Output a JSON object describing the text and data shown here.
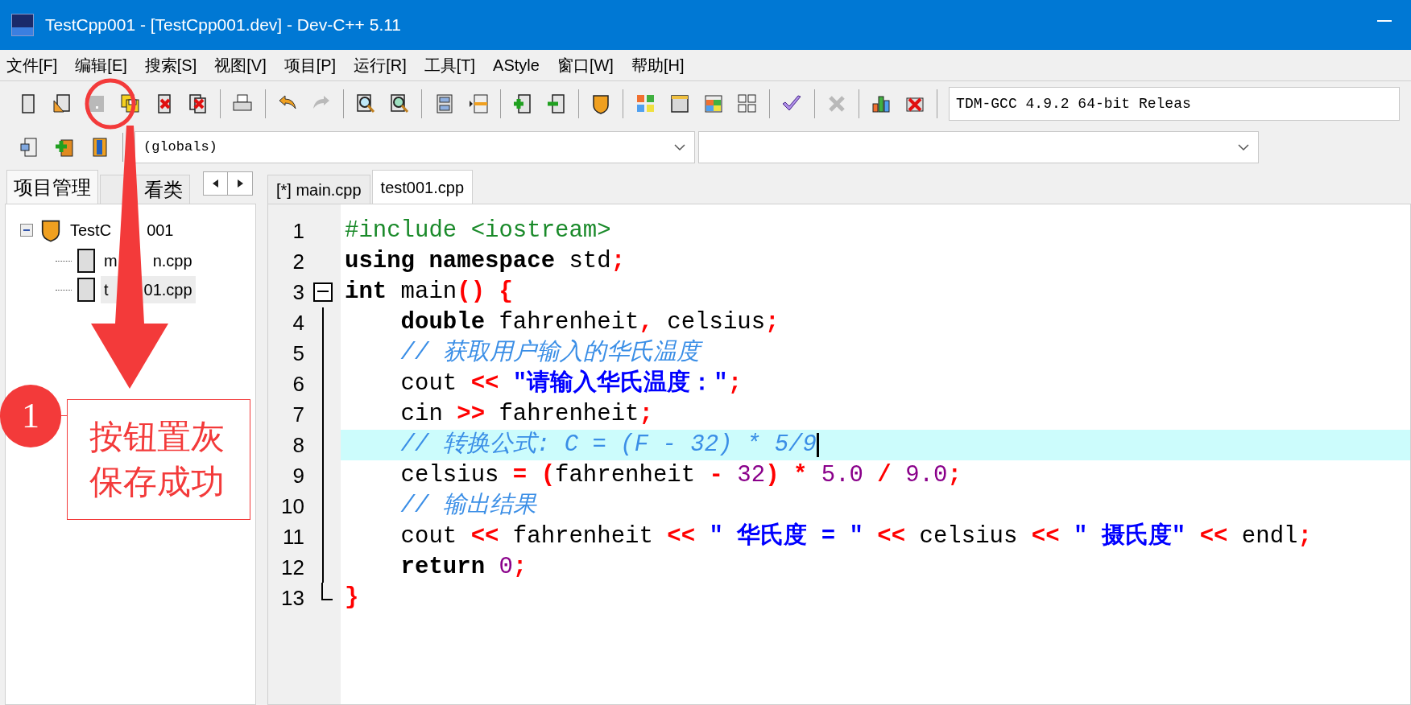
{
  "window": {
    "title": "TestCpp001 - [TestCpp001.dev] - Dev-C++ 5.11"
  },
  "menu": [
    "文件[F]",
    "编辑[E]",
    "搜索[S]",
    "视图[V]",
    "项目[P]",
    "运行[R]",
    "工具[T]",
    "AStyle",
    "窗口[W]",
    "帮助[H]"
  ],
  "toolbar": {
    "groups": [
      [
        {
          "kind": "page",
          "disabled": false
        },
        {
          "kind": "page-pencil",
          "disabled": false
        },
        {
          "kind": "save",
          "disabled": true
        },
        {
          "kind": "floppy-stack",
          "disabled": false
        },
        {
          "kind": "page-x",
          "disabled": false
        },
        {
          "kind": "pages-x",
          "disabled": false
        }
      ],
      [
        {
          "kind": "printer",
          "disabled": false
        }
      ],
      [
        {
          "kind": "undo-arrow",
          "disabled": false
        },
        {
          "kind": "redo-arrow",
          "disabled": true
        }
      ],
      [
        {
          "kind": "magnifier",
          "disabled": false
        },
        {
          "kind": "magnifier-page",
          "disabled": false
        }
      ],
      [
        {
          "kind": "panels",
          "disabled": false
        },
        {
          "kind": "split-bar",
          "disabled": false
        }
      ],
      [
        {
          "kind": "page-plus",
          "disabled": false
        },
        {
          "kind": "page-minus",
          "disabled": false
        }
      ],
      [
        {
          "kind": "shield",
          "disabled": false
        }
      ],
      [
        {
          "kind": "color-grid",
          "disabled": false
        },
        {
          "kind": "window",
          "disabled": false
        },
        {
          "kind": "tile-grid",
          "disabled": false
        },
        {
          "kind": "outline-grid",
          "disabled": false
        }
      ],
      [
        {
          "kind": "check",
          "disabled": false
        }
      ],
      [
        {
          "kind": "cross",
          "disabled": true
        }
      ],
      [
        {
          "kind": "bar-chart",
          "disabled": false
        },
        {
          "kind": "box-x",
          "disabled": false
        }
      ]
    ],
    "compiler": "TDM-GCC 4.9.2 64-bit Releas"
  },
  "toolbar2": {
    "buttons": [
      {
        "kind": "page-arrow",
        "disabled": false
      },
      {
        "kind": "box-plus",
        "disabled": false
      },
      {
        "kind": "bookmark",
        "disabled": false
      }
    ],
    "scope": "(globals)"
  },
  "side_tabs": [
    {
      "label": "项目管理",
      "selected": true,
      "covered_start": false
    },
    {
      "label": "看类",
      "selected": false,
      "covered_start": true
    }
  ],
  "project_tree": [
    {
      "label_parts": [
        "TestC",
        "001"
      ],
      "expanded": true,
      "selected": false,
      "children": [
        {
          "label_parts": [
            "m",
            "n.cpp"
          ],
          "selected": false
        },
        {
          "label_parts": [
            "t",
            "01.cpp"
          ],
          "selected": true
        }
      ]
    }
  ],
  "editor_tabs": [
    {
      "label": "[*] main.cpp",
      "selected": false
    },
    {
      "label": "test001.cpp",
      "selected": true
    }
  ],
  "code": {
    "lines": [
      {
        "number": "1",
        "current": false,
        "tokens": [
          {
            "kind": "pre",
            "text": "#include <iostream>"
          }
        ]
      },
      {
        "number": "2",
        "current": false,
        "tokens": [
          {
            "kind": "kw",
            "text": "using"
          },
          {
            "kind": "kw",
            "text": " namespace"
          },
          {
            "kind": "p",
            "text": " std"
          },
          {
            "kind": "sym",
            "text": ";"
          }
        ]
      },
      {
        "number": "3",
        "current": false,
        "fold_open": true,
        "tokens": [
          {
            "kind": "kw",
            "text": "int"
          },
          {
            "kind": "p",
            "text": " main"
          },
          {
            "kind": "sym",
            "text": "()"
          },
          {
            "kind": "sym",
            "text": " {"
          }
        ]
      },
      {
        "number": "4",
        "current": false,
        "tokens": [
          {
            "kind": "kw",
            "text": "    double"
          },
          {
            "kind": "p",
            "text": " fahrenheit"
          },
          {
            "kind": "sym",
            "text": ","
          },
          {
            "kind": "p",
            "text": " celsius"
          },
          {
            "kind": "sym",
            "text": ";"
          }
        ]
      },
      {
        "number": "5",
        "current": false,
        "tokens": [
          {
            "kind": "cm",
            "text": "    // 获取用户输入的华氏温度"
          }
        ]
      },
      {
        "number": "6",
        "current": false,
        "tokens": [
          {
            "kind": "p",
            "text": "    cout "
          },
          {
            "kind": "sym",
            "text": "<<"
          },
          {
            "kind": "str",
            "text": " \"请输入华氏温度：\""
          },
          {
            "kind": "sym",
            "text": ";"
          }
        ]
      },
      {
        "number": "7",
        "current": false,
        "tokens": [
          {
            "kind": "p",
            "text": "    cin "
          },
          {
            "kind": "sym",
            "text": ">>"
          },
          {
            "kind": "p",
            "text": " fahrenheit"
          },
          {
            "kind": "sym",
            "text": ";"
          }
        ]
      },
      {
        "number": "8",
        "current": true,
        "tokens": [
          {
            "kind": "cm",
            "text": "    // 转换公式: C = (F - 32) * 5/9"
          }
        ]
      },
      {
        "number": "9",
        "current": false,
        "tokens": [
          {
            "kind": "p",
            "text": "    celsius "
          },
          {
            "kind": "sym",
            "text": "="
          },
          {
            "kind": "sym",
            "text": " ("
          },
          {
            "kind": "p",
            "text": "fahrenheit "
          },
          {
            "kind": "sym",
            "text": "-"
          },
          {
            "kind": "num",
            "text": " 32"
          },
          {
            "kind": "sym",
            "text": ")"
          },
          {
            "kind": "sym",
            "text": " *"
          },
          {
            "kind": "num",
            "text": " 5.0"
          },
          {
            "kind": "sym",
            "text": " /"
          },
          {
            "kind": "num",
            "text": " 9.0"
          },
          {
            "kind": "sym",
            "text": ";"
          }
        ]
      },
      {
        "number": "10",
        "current": false,
        "tokens": [
          {
            "kind": "cm",
            "text": "    // 输出结果"
          }
        ]
      },
      {
        "number": "11",
        "current": false,
        "tokens": [
          {
            "kind": "p",
            "text": "    cout "
          },
          {
            "kind": "sym",
            "text": "<<"
          },
          {
            "kind": "p",
            "text": " fahrenheit "
          },
          {
            "kind": "sym",
            "text": "<<"
          },
          {
            "kind": "str",
            "text": " \" 华氏度 = \""
          },
          {
            "kind": "sym",
            "text": " <<"
          },
          {
            "kind": "p",
            "text": " celsius "
          },
          {
            "kind": "sym",
            "text": "<<"
          },
          {
            "kind": "str",
            "text": " \" 摄氏度\""
          },
          {
            "kind": "sym",
            "text": " <<"
          },
          {
            "kind": "p",
            "text": " endl"
          },
          {
            "kind": "sym",
            "text": ";"
          }
        ]
      },
      {
        "number": "12",
        "current": false,
        "tokens": [
          {
            "kind": "kw",
            "text": "    return"
          },
          {
            "kind": "num",
            "text": " 0"
          },
          {
            "kind": "sym",
            "text": ";"
          }
        ]
      },
      {
        "number": "13",
        "current": false,
        "fold_close": true,
        "tokens": [
          {
            "kind": "sym",
            "text": "}"
          }
        ]
      }
    ]
  },
  "annotation": {
    "number": "1",
    "text": "按钮置灰保存成功"
  }
}
